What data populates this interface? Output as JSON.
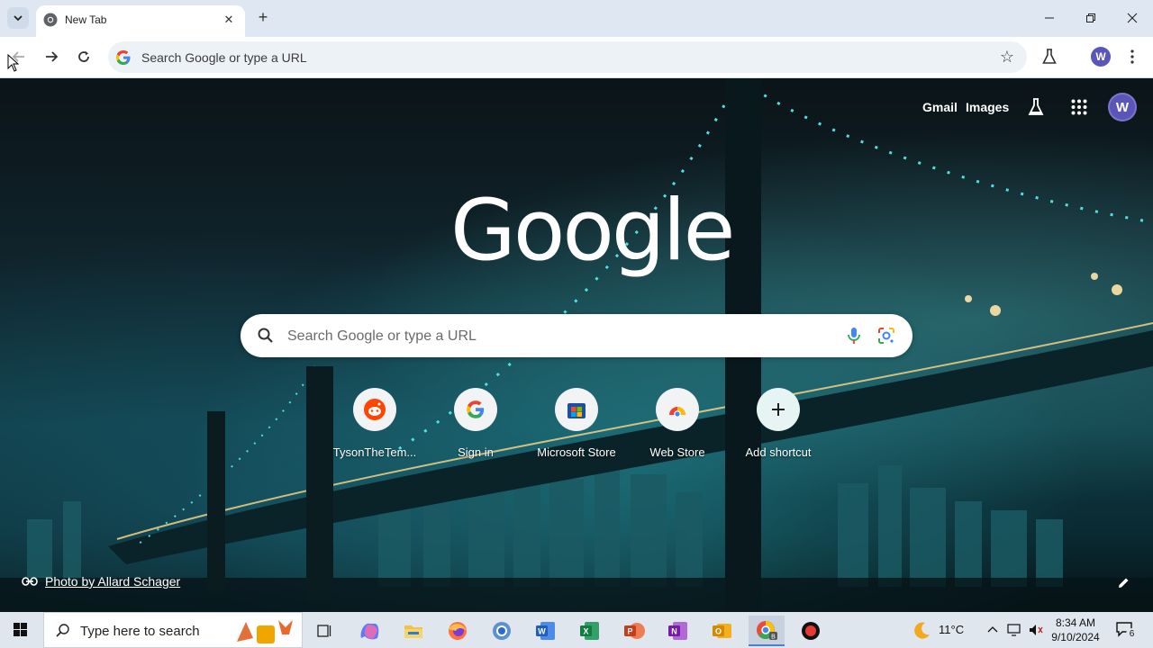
{
  "browser": {
    "tab_search_icon": "chevron-down-icon",
    "tab": {
      "title": "New Tab",
      "favicon": "chrome-icon",
      "close_icon": "close-icon"
    },
    "new_tab_icon": "plus-icon",
    "window_controls": [
      "minimize-icon",
      "restore-icon",
      "close-icon"
    ]
  },
  "toolbar": {
    "back_icon": "back-arrow-icon",
    "forward_icon": "forward-arrow-icon",
    "reload_icon": "reload-icon",
    "omnibox_placeholder": "Search Google or type a URL",
    "bookmark_icon": "star-icon",
    "labs_icon": "flask-icon",
    "profile_initial": "W",
    "menu_icon": "kebab-menu-icon"
  },
  "ntp": {
    "top_links": {
      "gmail": "Gmail",
      "images": "Images"
    },
    "labs_icon": "flask-icon",
    "apps_icon": "grid-apps-icon",
    "profile_initial": "W",
    "logo_text": "Google",
    "search_placeholder": "Search Google or type a URL",
    "shortcuts": [
      {
        "label": "TysonTheTem...",
        "icon": "reddit-icon"
      },
      {
        "label": "Sign in",
        "icon": "google-g-icon"
      },
      {
        "label": "Microsoft Store",
        "icon": "microsoft-store-icon"
      },
      {
        "label": "Web Store",
        "icon": "chrome-web-store-icon"
      },
      {
        "label": "Add shortcut",
        "icon": "plus-icon"
      }
    ],
    "photo_credit": "Photo by Allard Schager",
    "customize_icon": "pencil-icon"
  },
  "taskbar": {
    "search_placeholder": "Type here to search",
    "apps": [
      "task-view-icon",
      "copilot-icon",
      "file-explorer-icon",
      "firefox-icon",
      "chrome-icon",
      "word-icon",
      "excel-icon",
      "powerpoint-icon",
      "onenote-icon",
      "outlook-icon",
      "chrome-profile-icon",
      "record-icon"
    ],
    "weather": {
      "temp": "11°C",
      "icon": "moon-icon"
    },
    "time": "8:34 AM",
    "date": "9/10/2024",
    "notification_count": "6"
  },
  "colors": {
    "accent": "#5a55b8",
    "toolbar_bg": "#ffffff",
    "tabstrip_bg": "#dfe8f2"
  }
}
